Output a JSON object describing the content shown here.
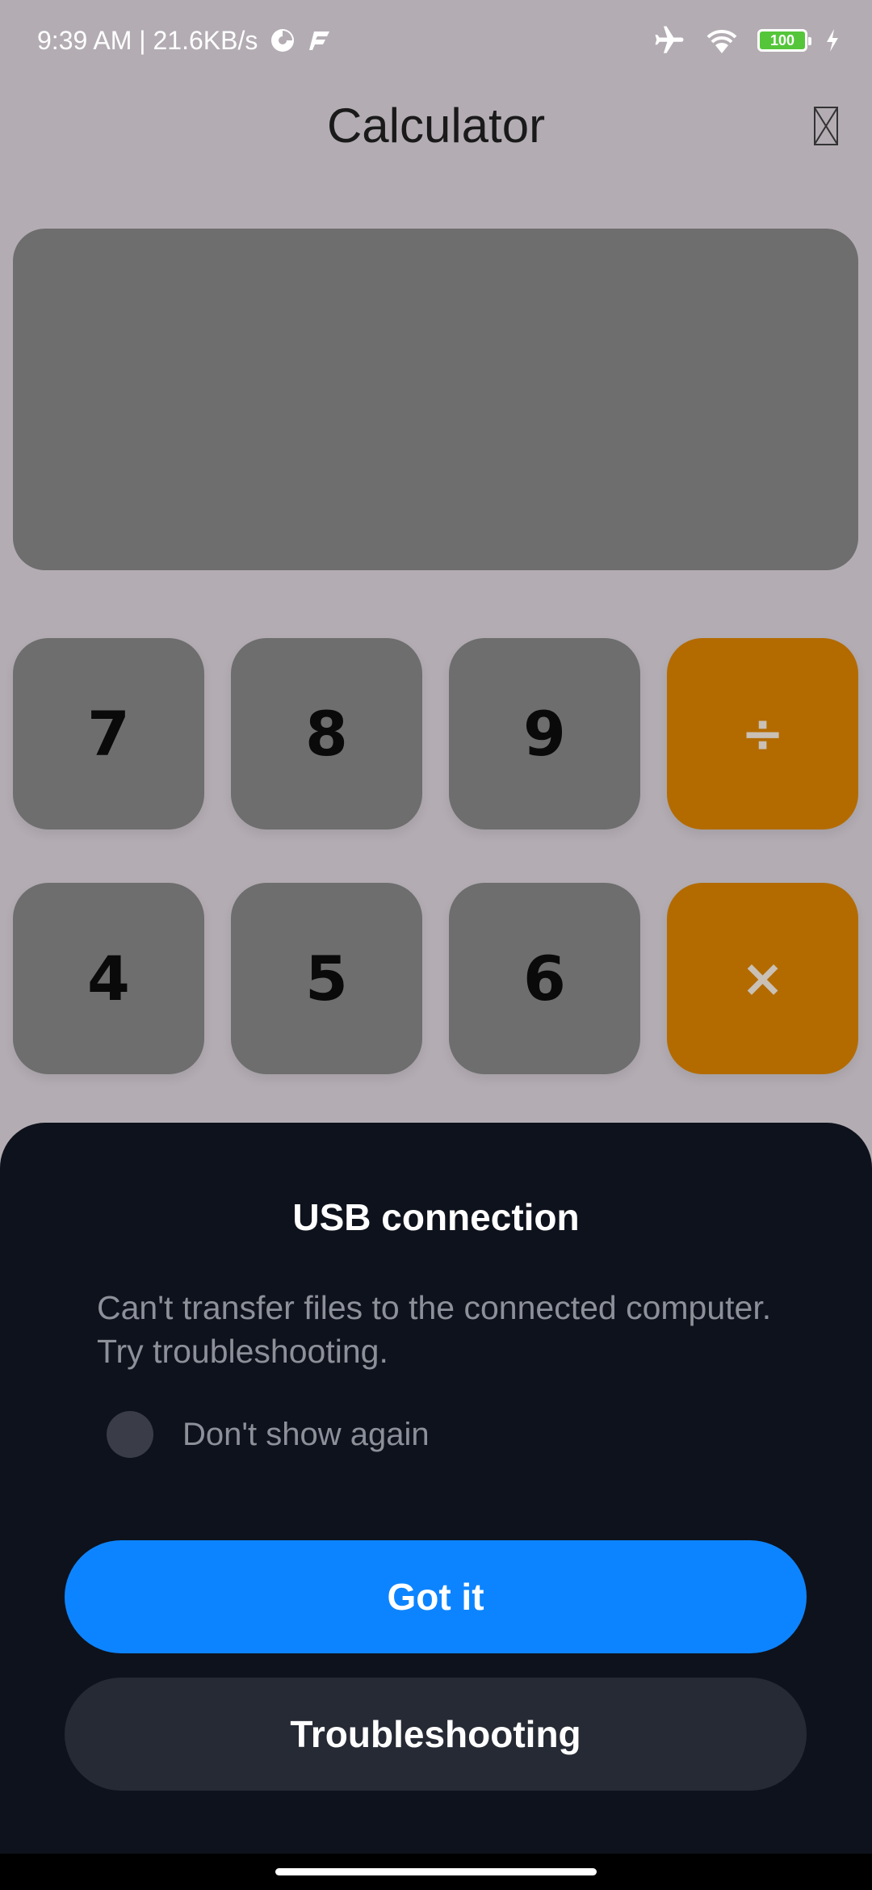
{
  "status_bar": {
    "time_speed": "9:39 AM | 21.6KB/s",
    "battery": "100",
    "icons": [
      "data-saver-icon",
      "app-notification-icon",
      "airplane-icon",
      "wifi-icon",
      "battery-icon",
      "charging-icon"
    ]
  },
  "header": {
    "title": "Calculator",
    "icon": "missing-glyph-icon"
  },
  "display": {
    "value": ""
  },
  "keypad": {
    "rows": [
      [
        "7",
        "8",
        "9",
        "÷"
      ],
      [
        "4",
        "5",
        "6",
        "×"
      ]
    ]
  },
  "dialog": {
    "title": "USB connection",
    "message": "Can't transfer files to the connected computer. Try troubleshooting.",
    "checkbox_label": "Don't show again",
    "primary_button": "Got it",
    "secondary_button": "Troubleshooting"
  },
  "colors": {
    "background": "#b3adb3",
    "key": "#6e6e6e",
    "operator_key": "#b36b00",
    "sheet": "#0e121c",
    "primary_button": "#0d84ff",
    "secondary_button": "#262a34"
  }
}
